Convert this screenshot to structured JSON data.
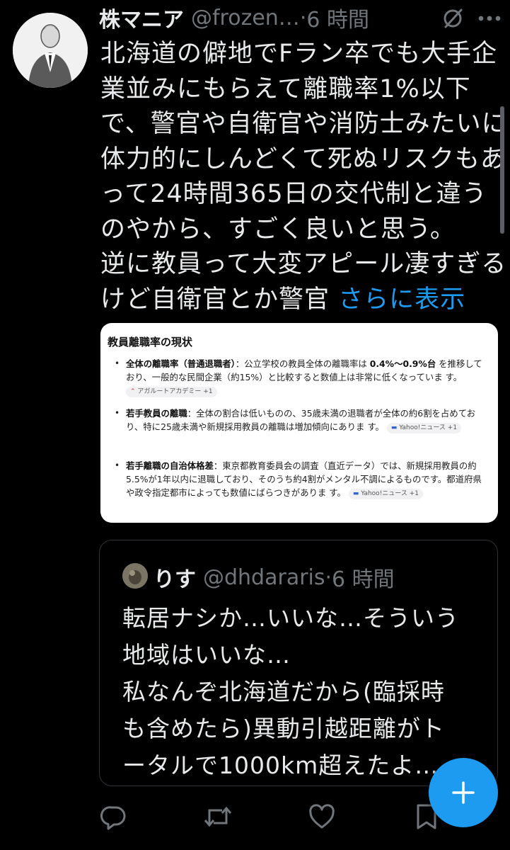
{
  "post": {
    "author_name": "株マニア",
    "handle": "@frozen…",
    "dot": "·",
    "time": "6 時間",
    "text_lines": [
      "北海道の僻地でFラン卒でも大手企",
      "業並みにもらえて離職率1%以下",
      "で、警官や自衛官や消防士みたいに",
      "体力的にしんどくて死ぬリスクもあ",
      "って24時間365日の交代制と違う",
      "のやから、すごく良いと思う。",
      "逆に教員って大変アピール凄すぎる"
    ],
    "last_line": "けど自衛官とか警官",
    "show_more": "さらに表示"
  },
  "card": {
    "title": "教員離職率の現状",
    "items": [
      {
        "label": "全体の離職率（普通退職者）",
        "text_before": "：公立学校の教員全体の離職率は ",
        "highlight": "0.4%〜0.9%台",
        "text_after": " を推移しており、一般的な民間企業（約15%）と比較すると数値上は非常に低くなっていま す。",
        "source": "アガルートアカデミー +1"
      },
      {
        "label": "若手教員の離職",
        "text": "：全体の割合は低いものの、35歳未満の退職者が全体の約6割を占めており、特に25歳未満や新規採用教員の離職は増加傾向にありま す。",
        "source": "Yahoo!ニュース +1"
      },
      {
        "label": "若手離職の自治体格差",
        "text": "：東京都教育委員会の調査（直近データ）では、新規採用教員の約5.5%が1年以内に退職しており、そのうち約4割がメンタル不調によるものです。都道府県や政令指定都市によっても数値にばらつきがありま す。",
        "source": "Yahoo!ニュース +1"
      }
    ]
  },
  "quote": {
    "author_name": "りす",
    "handle": "@dhdararis",
    "dot": "·",
    "time": "6 時間",
    "text_lines": [
      "転居ナシか…いいな…そういう",
      "地域はいいな…",
      "私なんぞ北海道だから(臨採時",
      "も含めたら)異動引越距離がト",
      "ータルで1000km超えたよ…"
    ]
  },
  "icons": {
    "grok": "grok-icon",
    "more": "more-icon",
    "reply": "reply-icon",
    "repost": "repost-icon",
    "like": "like-icon",
    "bookmark": "bookmark-icon",
    "compose": "compose-plus-icon"
  },
  "colors": {
    "background": "#000000",
    "text": "#e7e9ea",
    "muted": "#71767b",
    "accent": "#1d9bf0",
    "border": "#2f3336"
  }
}
